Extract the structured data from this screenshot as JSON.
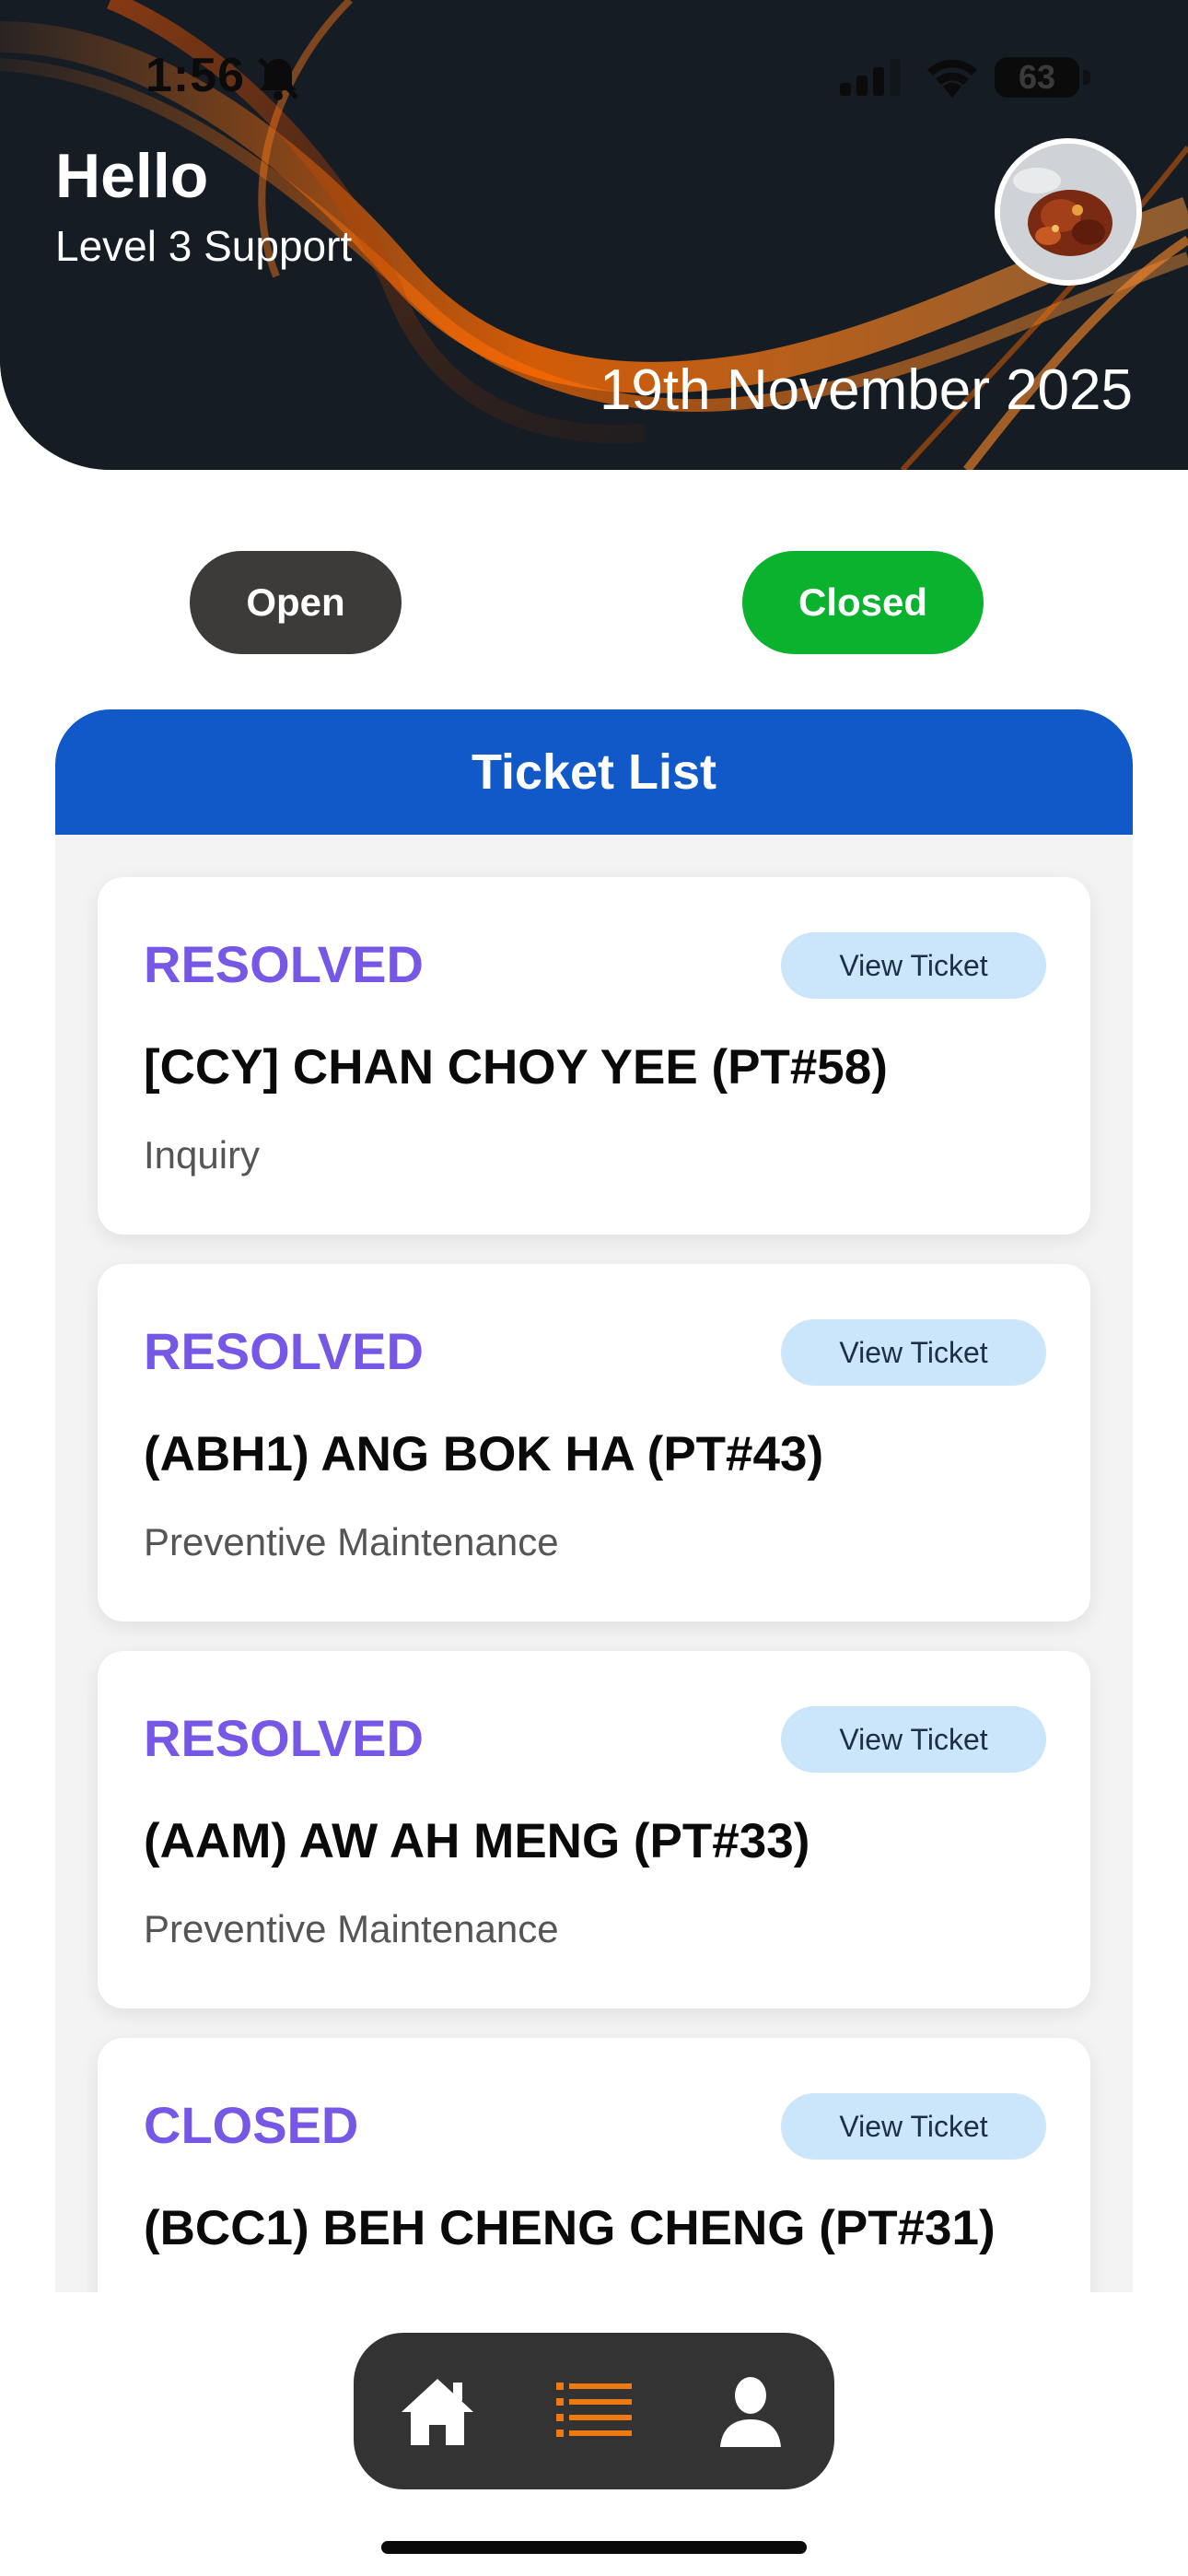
{
  "status_bar": {
    "time": "1:56",
    "battery": "63",
    "icons": [
      "bell-slash-icon",
      "cellular-signal-icon",
      "wifi-icon",
      "battery-icon"
    ]
  },
  "header": {
    "greeting": "Hello",
    "role": "Level 3 Support",
    "date": "19th November 2025"
  },
  "filters": {
    "open_label": "Open",
    "closed_label": "Closed",
    "active": "Closed",
    "open_color": "#3d3b3a",
    "closed_color": "#0ab22e"
  },
  "ticket_list": {
    "title": "Ticket List",
    "header_color": "#1158c8",
    "status_color": "#7657e6",
    "tickets": [
      {
        "status": "RESOLVED",
        "title": "[CCY] CHAN CHOY YEE (PT#58)",
        "type": "Inquiry",
        "action": "View Ticket"
      },
      {
        "status": "RESOLVED",
        "title": "(ABH1) ANG BOK HA (PT#43)",
        "type": "Preventive Maintenance",
        "action": "View Ticket"
      },
      {
        "status": "RESOLVED",
        "title": "(AAM) AW AH MENG (PT#33)",
        "type": "Preventive Maintenance",
        "action": "View Ticket"
      },
      {
        "status": "CLOSED",
        "title": "(BCC1) BEH CHENG CHENG (PT#31)",
        "type": "",
        "action": "View Ticket"
      }
    ]
  },
  "bottom_nav": {
    "items": [
      {
        "icon": "home-icon",
        "active": false
      },
      {
        "icon": "list-icon",
        "active": true
      },
      {
        "icon": "profile-icon",
        "active": false
      }
    ],
    "active_color": "#f07a12"
  }
}
